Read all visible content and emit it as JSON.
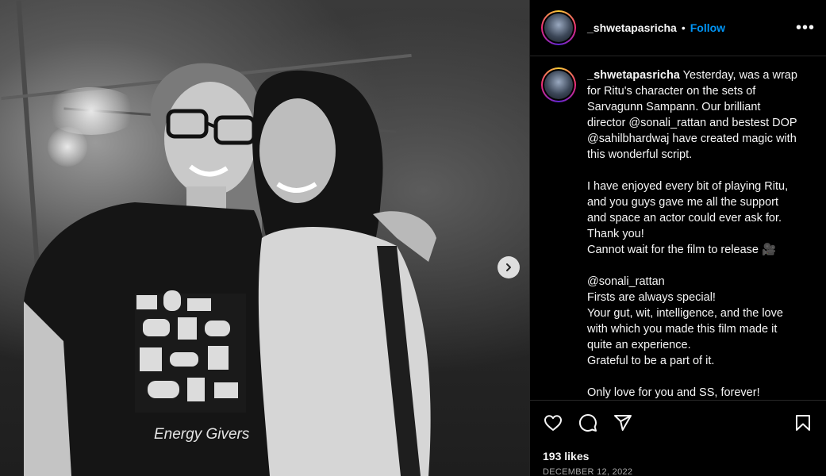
{
  "post": {
    "image": {
      "shirt_text": "Energy Givers",
      "next_icon": "chevron-right-icon"
    },
    "header": {
      "username": "_shwetapasricha",
      "separator": "•",
      "follow_label": "Follow",
      "more_label": "•••"
    },
    "caption": {
      "username": "_shwetapasricha",
      "lines": [
        " Yesterday, was a wrap for Ritu's character on the sets of Sarvagunn Sampann. Our brilliant director @sonali_rattan and bestest DOP @sahilbhardwaj have created magic with this wonderful script.",
        "",
        "I have enjoyed every bit of playing Ritu, and you guys gave me all the support and space an actor could ever ask for. Thank you!",
        "Cannot wait for the film to release 🎥",
        "",
        "@sonali_rattan",
        "Firsts are always special!",
        "Your gut, wit, intelligence, and the love with which you made this film made it quite an experience.",
        "Grateful to be a part of it.",
        "",
        "Only love for you and SS, forever!"
      ]
    },
    "actions": {
      "like_icon": "heart-icon",
      "comment_icon": "comment-icon",
      "share_icon": "send-icon",
      "save_icon": "bookmark-icon"
    },
    "likes": "193 likes",
    "date": "December 12, 2022"
  }
}
